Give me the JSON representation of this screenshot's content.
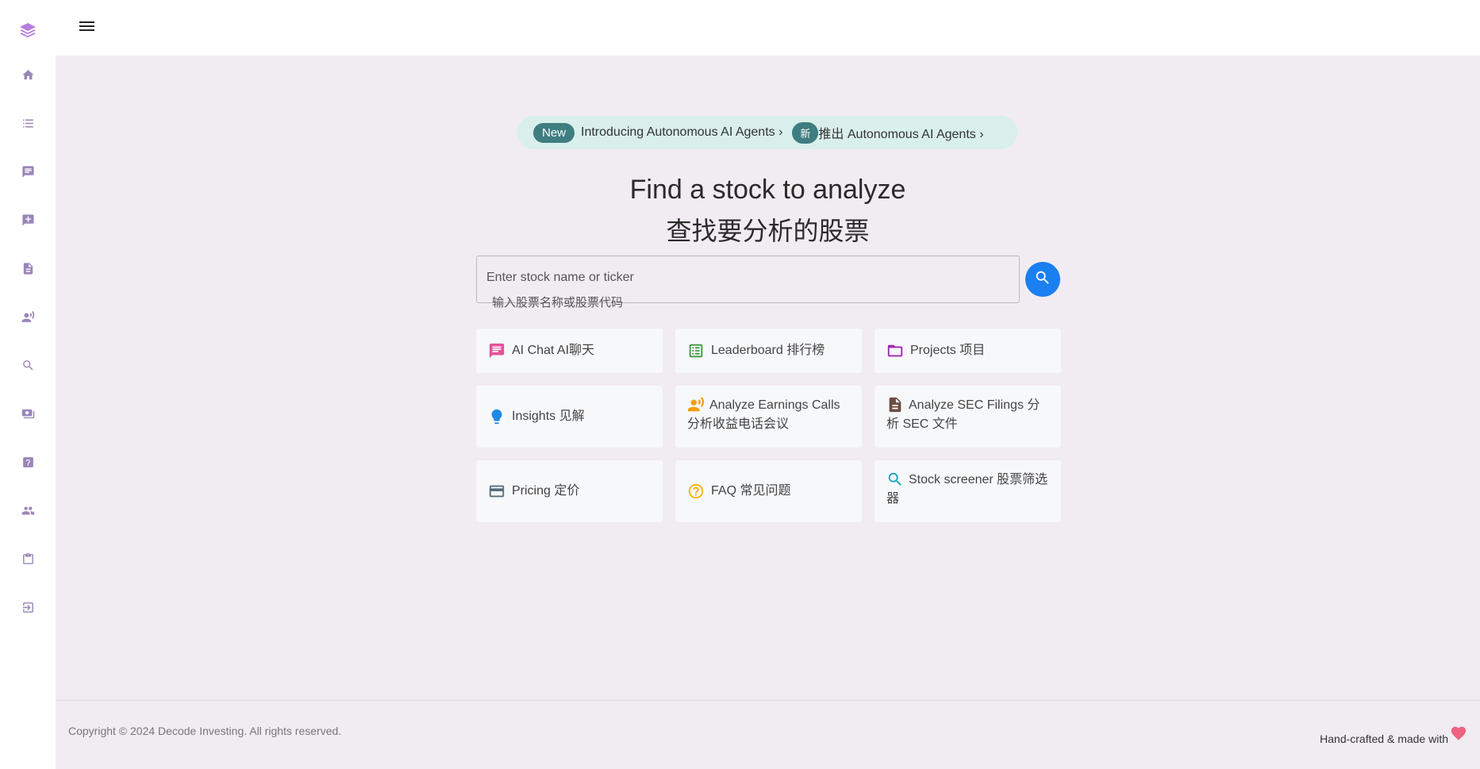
{
  "sidebar": {
    "logo_icon": "layers-icon",
    "items": [
      {
        "icon": "home-icon"
      },
      {
        "icon": "list-icon"
      },
      {
        "icon": "chat-icon"
      },
      {
        "icon": "add-comment-icon"
      },
      {
        "icon": "document-icon"
      },
      {
        "icon": "voice-icon"
      },
      {
        "icon": "search-icon"
      },
      {
        "icon": "money-icon"
      },
      {
        "icon": "help-icon"
      },
      {
        "icon": "people-icon"
      },
      {
        "icon": "clipboard-icon"
      },
      {
        "icon": "logout-icon"
      }
    ]
  },
  "banner": {
    "new_pill": "New",
    "text_en": "Introducing Autonomous AI Agents ›",
    "new_pill_zh": "新",
    "text_zh": "推出 Autonomous AI Agents ›"
  },
  "headline": {
    "en": "Find a stock to analyze",
    "zh": "查找要分析的股票"
  },
  "search": {
    "placeholder": "Enter stock name or ticker",
    "sub_label": "输入股票名称或股票代码"
  },
  "cards": [
    {
      "label": "AI Chat AI聊天",
      "icon": "chat-icon",
      "color": "#e8509c"
    },
    {
      "label": "Leaderboard 排行榜",
      "icon": "leaderboard-icon",
      "color": "#3a9a3e"
    },
    {
      "label": "Projects 项目",
      "icon": "folder-icon",
      "color": "#9c27b0"
    },
    {
      "label": "Insights 见解",
      "icon": "lightbulb-icon",
      "color": "#1e88e5"
    },
    {
      "label": "Analyze Earnings Calls 分析收益电话会议",
      "icon": "earnings-call-icon",
      "color": "#f39c12"
    },
    {
      "label": "Analyze SEC Filings 分析 SEC 文件",
      "icon": "document-icon",
      "color": "#6d4c41"
    },
    {
      "label": "Pricing 定价",
      "icon": "credit-card-icon",
      "color": "#546e7a"
    },
    {
      "label": "FAQ 常见问题",
      "icon": "help-circle-icon",
      "color": "#f5b300"
    },
    {
      "label": "Stock screener 股票筛选器",
      "icon": "search-icon",
      "color": "#17a2b8"
    }
  ],
  "footer": {
    "copyright": "Copyright © 2024 Decode Investing. All rights reserved.",
    "madewith": "Hand-crafted & made with",
    "heart_color": "#f0617f"
  },
  "colors": {
    "accent": "#1a7ff0",
    "background": "#f1ecf2",
    "pill": "#3e7d80"
  }
}
